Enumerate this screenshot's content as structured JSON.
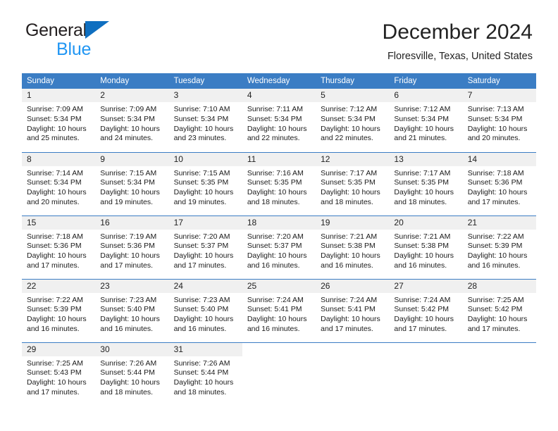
{
  "brand": {
    "word1": "General",
    "word2": "Blue",
    "triangle_color": "#0f6fc0",
    "blue_text_color": "#2196f3"
  },
  "header": {
    "title": "December 2024",
    "subtitle": "Floresville, Texas, United States"
  },
  "theme": {
    "header_bg": "#3b7dc4",
    "daynum_bg": "#f0f0f0",
    "row_rule": "#3b7dc4",
    "text": "#1a1a1a"
  },
  "weekdays": [
    "Sunday",
    "Monday",
    "Tuesday",
    "Wednesday",
    "Thursday",
    "Friday",
    "Saturday"
  ],
  "weeks": [
    [
      {
        "day": "1",
        "sunrise": "Sunrise: 7:09 AM",
        "sunset": "Sunset: 5:34 PM",
        "daylight1": "Daylight: 10 hours",
        "daylight2": "and 25 minutes."
      },
      {
        "day": "2",
        "sunrise": "Sunrise: 7:09 AM",
        "sunset": "Sunset: 5:34 PM",
        "daylight1": "Daylight: 10 hours",
        "daylight2": "and 24 minutes."
      },
      {
        "day": "3",
        "sunrise": "Sunrise: 7:10 AM",
        "sunset": "Sunset: 5:34 PM",
        "daylight1": "Daylight: 10 hours",
        "daylight2": "and 23 minutes."
      },
      {
        "day": "4",
        "sunrise": "Sunrise: 7:11 AM",
        "sunset": "Sunset: 5:34 PM",
        "daylight1": "Daylight: 10 hours",
        "daylight2": "and 22 minutes."
      },
      {
        "day": "5",
        "sunrise": "Sunrise: 7:12 AM",
        "sunset": "Sunset: 5:34 PM",
        "daylight1": "Daylight: 10 hours",
        "daylight2": "and 22 minutes."
      },
      {
        "day": "6",
        "sunrise": "Sunrise: 7:12 AM",
        "sunset": "Sunset: 5:34 PM",
        "daylight1": "Daylight: 10 hours",
        "daylight2": "and 21 minutes."
      },
      {
        "day": "7",
        "sunrise": "Sunrise: 7:13 AM",
        "sunset": "Sunset: 5:34 PM",
        "daylight1": "Daylight: 10 hours",
        "daylight2": "and 20 minutes."
      }
    ],
    [
      {
        "day": "8",
        "sunrise": "Sunrise: 7:14 AM",
        "sunset": "Sunset: 5:34 PM",
        "daylight1": "Daylight: 10 hours",
        "daylight2": "and 20 minutes."
      },
      {
        "day": "9",
        "sunrise": "Sunrise: 7:15 AM",
        "sunset": "Sunset: 5:34 PM",
        "daylight1": "Daylight: 10 hours",
        "daylight2": "and 19 minutes."
      },
      {
        "day": "10",
        "sunrise": "Sunrise: 7:15 AM",
        "sunset": "Sunset: 5:35 PM",
        "daylight1": "Daylight: 10 hours",
        "daylight2": "and 19 minutes."
      },
      {
        "day": "11",
        "sunrise": "Sunrise: 7:16 AM",
        "sunset": "Sunset: 5:35 PM",
        "daylight1": "Daylight: 10 hours",
        "daylight2": "and 18 minutes."
      },
      {
        "day": "12",
        "sunrise": "Sunrise: 7:17 AM",
        "sunset": "Sunset: 5:35 PM",
        "daylight1": "Daylight: 10 hours",
        "daylight2": "and 18 minutes."
      },
      {
        "day": "13",
        "sunrise": "Sunrise: 7:17 AM",
        "sunset": "Sunset: 5:35 PM",
        "daylight1": "Daylight: 10 hours",
        "daylight2": "and 18 minutes."
      },
      {
        "day": "14",
        "sunrise": "Sunrise: 7:18 AM",
        "sunset": "Sunset: 5:36 PM",
        "daylight1": "Daylight: 10 hours",
        "daylight2": "and 17 minutes."
      }
    ],
    [
      {
        "day": "15",
        "sunrise": "Sunrise: 7:18 AM",
        "sunset": "Sunset: 5:36 PM",
        "daylight1": "Daylight: 10 hours",
        "daylight2": "and 17 minutes."
      },
      {
        "day": "16",
        "sunrise": "Sunrise: 7:19 AM",
        "sunset": "Sunset: 5:36 PM",
        "daylight1": "Daylight: 10 hours",
        "daylight2": "and 17 minutes."
      },
      {
        "day": "17",
        "sunrise": "Sunrise: 7:20 AM",
        "sunset": "Sunset: 5:37 PM",
        "daylight1": "Daylight: 10 hours",
        "daylight2": "and 17 minutes."
      },
      {
        "day": "18",
        "sunrise": "Sunrise: 7:20 AM",
        "sunset": "Sunset: 5:37 PM",
        "daylight1": "Daylight: 10 hours",
        "daylight2": "and 16 minutes."
      },
      {
        "day": "19",
        "sunrise": "Sunrise: 7:21 AM",
        "sunset": "Sunset: 5:38 PM",
        "daylight1": "Daylight: 10 hours",
        "daylight2": "and 16 minutes."
      },
      {
        "day": "20",
        "sunrise": "Sunrise: 7:21 AM",
        "sunset": "Sunset: 5:38 PM",
        "daylight1": "Daylight: 10 hours",
        "daylight2": "and 16 minutes."
      },
      {
        "day": "21",
        "sunrise": "Sunrise: 7:22 AM",
        "sunset": "Sunset: 5:39 PM",
        "daylight1": "Daylight: 10 hours",
        "daylight2": "and 16 minutes."
      }
    ],
    [
      {
        "day": "22",
        "sunrise": "Sunrise: 7:22 AM",
        "sunset": "Sunset: 5:39 PM",
        "daylight1": "Daylight: 10 hours",
        "daylight2": "and 16 minutes."
      },
      {
        "day": "23",
        "sunrise": "Sunrise: 7:23 AM",
        "sunset": "Sunset: 5:40 PM",
        "daylight1": "Daylight: 10 hours",
        "daylight2": "and 16 minutes."
      },
      {
        "day": "24",
        "sunrise": "Sunrise: 7:23 AM",
        "sunset": "Sunset: 5:40 PM",
        "daylight1": "Daylight: 10 hours",
        "daylight2": "and 16 minutes."
      },
      {
        "day": "25",
        "sunrise": "Sunrise: 7:24 AM",
        "sunset": "Sunset: 5:41 PM",
        "daylight1": "Daylight: 10 hours",
        "daylight2": "and 16 minutes."
      },
      {
        "day": "26",
        "sunrise": "Sunrise: 7:24 AM",
        "sunset": "Sunset: 5:41 PM",
        "daylight1": "Daylight: 10 hours",
        "daylight2": "and 17 minutes."
      },
      {
        "day": "27",
        "sunrise": "Sunrise: 7:24 AM",
        "sunset": "Sunset: 5:42 PM",
        "daylight1": "Daylight: 10 hours",
        "daylight2": "and 17 minutes."
      },
      {
        "day": "28",
        "sunrise": "Sunrise: 7:25 AM",
        "sunset": "Sunset: 5:42 PM",
        "daylight1": "Daylight: 10 hours",
        "daylight2": "and 17 minutes."
      }
    ],
    [
      {
        "day": "29",
        "sunrise": "Sunrise: 7:25 AM",
        "sunset": "Sunset: 5:43 PM",
        "daylight1": "Daylight: 10 hours",
        "daylight2": "and 17 minutes."
      },
      {
        "day": "30",
        "sunrise": "Sunrise: 7:26 AM",
        "sunset": "Sunset: 5:44 PM",
        "daylight1": "Daylight: 10 hours",
        "daylight2": "and 18 minutes."
      },
      {
        "day": "31",
        "sunrise": "Sunrise: 7:26 AM",
        "sunset": "Sunset: 5:44 PM",
        "daylight1": "Daylight: 10 hours",
        "daylight2": "and 18 minutes."
      },
      {
        "day": "",
        "sunrise": "",
        "sunset": "",
        "daylight1": "",
        "daylight2": ""
      },
      {
        "day": "",
        "sunrise": "",
        "sunset": "",
        "daylight1": "",
        "daylight2": ""
      },
      {
        "day": "",
        "sunrise": "",
        "sunset": "",
        "daylight1": "",
        "daylight2": ""
      },
      {
        "day": "",
        "sunrise": "",
        "sunset": "",
        "daylight1": "",
        "daylight2": ""
      }
    ]
  ]
}
